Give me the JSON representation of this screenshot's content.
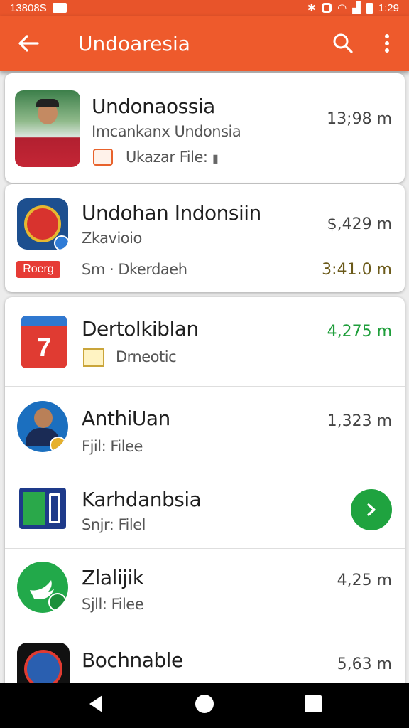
{
  "status_bar": {
    "left_text": "13808S",
    "time": "1:29"
  },
  "app_bar": {
    "title": "Undoaresia"
  },
  "items": [
    {
      "name": "Undonaossia",
      "subtitle": "Imcankanx Undonsia",
      "detail": "Ukazar File:",
      "value": "13;98 m"
    },
    {
      "name": "Undohan Indonsiin",
      "subtitle": "Zkavioio",
      "badge": "Roerg",
      "detail": "Sm · Dkerdaeh",
      "value": "$,429 m",
      "value2": "3:41.0 m"
    },
    {
      "name": "Dertolkiblan",
      "detail": "Drneotic",
      "value": "4,275 m",
      "value_color": "#1e9e3a"
    },
    {
      "name": "AnthiUan",
      "detail": "Fjil: Filee",
      "value": "1,323 m"
    },
    {
      "name": "Karhdanbsia",
      "detail": "Snjr: Filel"
    },
    {
      "name": "Zlalijik",
      "detail": "Sjll: Filee",
      "value": "4,25 m"
    },
    {
      "name": "Bochnable",
      "value": "5,63 m"
    }
  ],
  "colors": {
    "accent": "#ee5a2c",
    "green": "#1fa33f"
  }
}
